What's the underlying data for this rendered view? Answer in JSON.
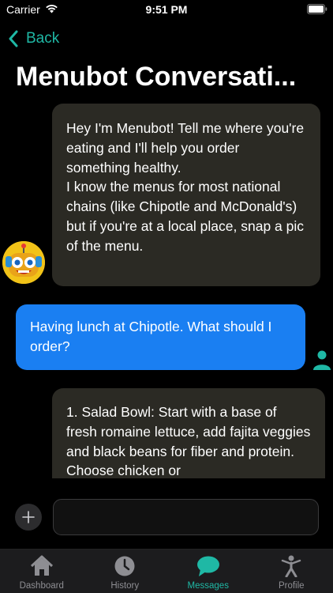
{
  "status_bar": {
    "carrier": "Carrier",
    "time": "9:51 PM"
  },
  "nav": {
    "back_label": "Back",
    "title": "Menubot Conversati..."
  },
  "messages": [
    {
      "sender": "bot",
      "text": "Hey I'm Menubot! Tell me where you're eating and I'll help you order something healthy.\nI know the menus for most national chains (like Chipotle and McDonald's) but if you're at a local place, snap a pic of the menu."
    },
    {
      "sender": "user",
      "text": "Having lunch at Chipotle. What should I order?"
    },
    {
      "sender": "bot",
      "text": "1. Salad Bowl: Start with a base of fresh romaine lettuce, add fajita veggies and black beans for fiber and protein. Choose chicken or"
    }
  ],
  "composer": {
    "placeholder": ""
  },
  "tabs": [
    {
      "label": "Dashboard",
      "icon": "house-icon",
      "active": false
    },
    {
      "label": "History",
      "icon": "clock-icon",
      "active": false
    },
    {
      "label": "Messages",
      "icon": "chat-bubble-icon",
      "active": true
    },
    {
      "label": "Profile",
      "icon": "person-icon",
      "active": false
    }
  ],
  "colors": {
    "accent": "#1fb8a5",
    "user_bubble": "#1a7ff2",
    "bot_bubble": "#2b2a24",
    "background": "#000000"
  }
}
